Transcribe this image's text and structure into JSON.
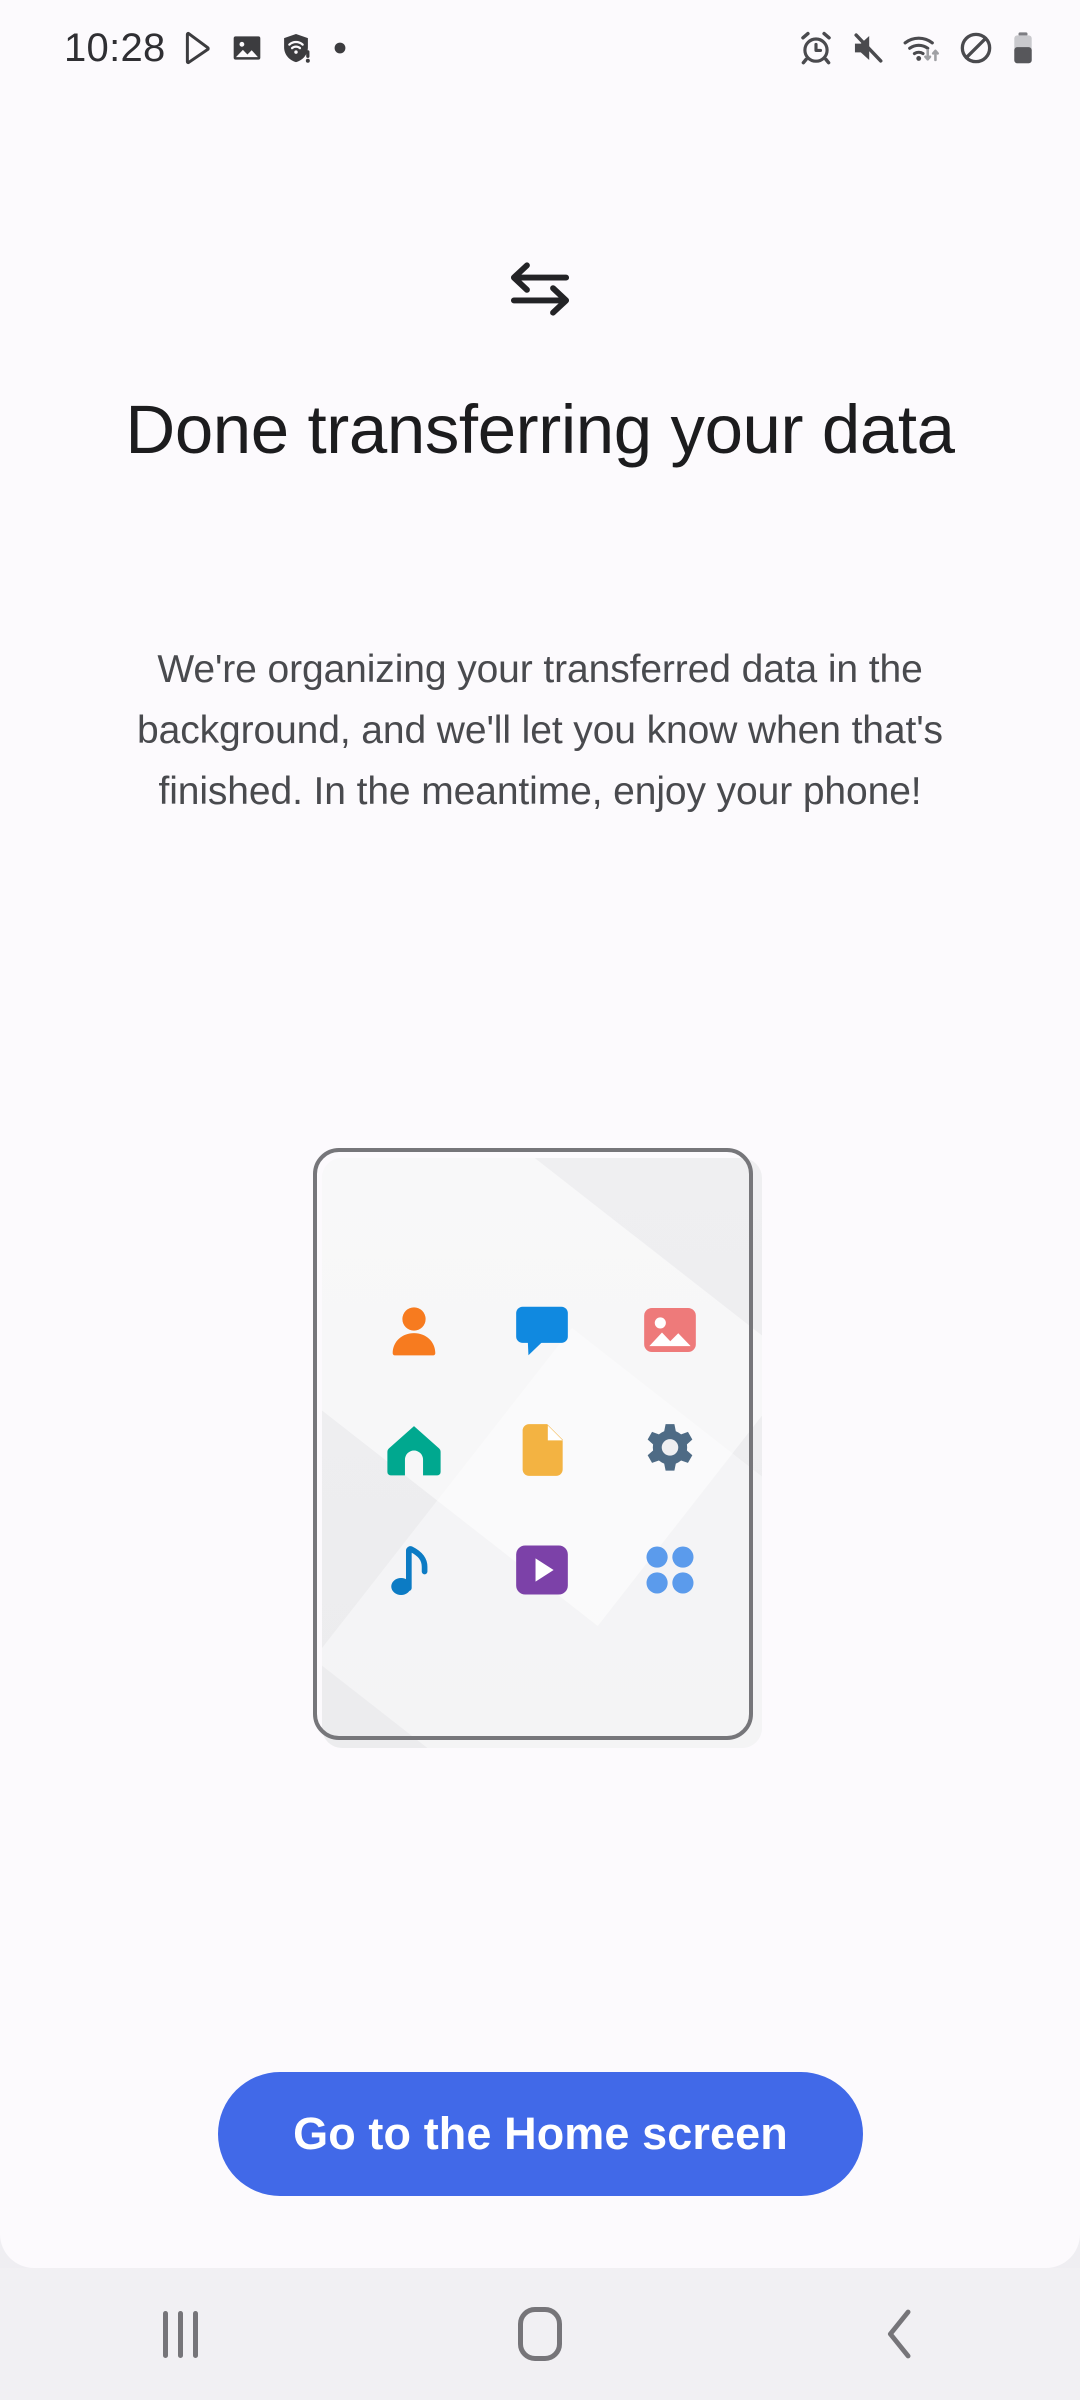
{
  "status_bar": {
    "time": "10:28",
    "left_icons": [
      "play-store-icon",
      "gallery-image-icon",
      "wifi-shield-warning-icon",
      "notification-dot-icon"
    ],
    "right_icons": [
      "alarm-icon",
      "mute-icon",
      "wifi-data-icon",
      "do-not-disturb-icon",
      "battery-icon"
    ],
    "text_color": "#2F2F33"
  },
  "header": {
    "icon": "transfer-arrows-icon",
    "title": "Done transferring your data",
    "body": "We're organizing your transferred data in the background, and we'll let you know when that's finished. In the meantime, enjoy your phone!"
  },
  "illustration": {
    "name": "phone-with-apps-illustration",
    "frame_color": "#76767A",
    "screen_color": "#EFEFF1",
    "apps": [
      {
        "name": "contacts-icon",
        "color": "#F77B1F"
      },
      {
        "name": "messages-icon",
        "color": "#1089E0"
      },
      {
        "name": "gallery-icon",
        "color": "#EE7A7A"
      },
      {
        "name": "home-icon",
        "color": "#00A88F"
      },
      {
        "name": "documents-icon",
        "color": "#F3B342"
      },
      {
        "name": "settings-icon",
        "color": "#4E6B85"
      },
      {
        "name": "music-icon",
        "color": "#0C7BC4"
      },
      {
        "name": "video-icon",
        "color": "#7C41A8"
      },
      {
        "name": "apps-grid-icon",
        "color": "#5B9BEC"
      }
    ]
  },
  "cta": {
    "label": "Go to the Home screen",
    "background": "#4169E8",
    "text_color": "#FFFFFF"
  },
  "nav_bar": {
    "background": "#F1F0F3",
    "icon_color": "#767579",
    "buttons": [
      {
        "name": "recents-button",
        "icon": "recents-icon"
      },
      {
        "name": "home-button",
        "icon": "home-button-icon"
      },
      {
        "name": "back-button",
        "icon": "back-chevron-icon"
      }
    ]
  },
  "theme": {
    "background": "#FCFAFD",
    "title_color": "#1C1C1E",
    "body_color": "#494A4E"
  }
}
